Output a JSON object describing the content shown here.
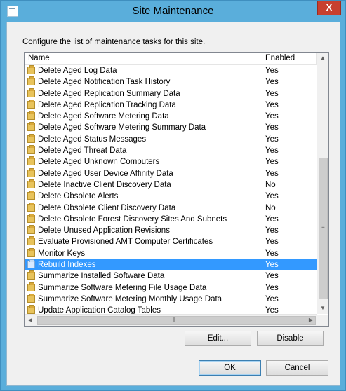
{
  "window": {
    "title": "Site Maintenance",
    "close_label": "X"
  },
  "description": "Configure the list of maintenance tasks for this site.",
  "list": {
    "columns": {
      "name": "Name",
      "enabled": "Enabled"
    },
    "rows": [
      {
        "name": "Delete Aged Log Data",
        "enabled": "Yes",
        "selected": false
      },
      {
        "name": "Delete Aged Notification Task History",
        "enabled": "Yes",
        "selected": false
      },
      {
        "name": "Delete Aged Replication Summary Data",
        "enabled": "Yes",
        "selected": false
      },
      {
        "name": "Delete Aged Replication Tracking Data",
        "enabled": "Yes",
        "selected": false
      },
      {
        "name": "Delete Aged Software Metering Data",
        "enabled": "Yes",
        "selected": false
      },
      {
        "name": "Delete Aged Software Metering Summary Data",
        "enabled": "Yes",
        "selected": false
      },
      {
        "name": "Delete Aged Status Messages",
        "enabled": "Yes",
        "selected": false
      },
      {
        "name": "Delete Aged Threat Data",
        "enabled": "Yes",
        "selected": false
      },
      {
        "name": "Delete Aged Unknown Computers",
        "enabled": "Yes",
        "selected": false
      },
      {
        "name": "Delete Aged User Device Affinity Data",
        "enabled": "Yes",
        "selected": false
      },
      {
        "name": "Delete Inactive Client Discovery Data",
        "enabled": "No",
        "selected": false
      },
      {
        "name": "Delete Obsolete Alerts",
        "enabled": "Yes",
        "selected": false
      },
      {
        "name": "Delete Obsolete Client Discovery Data",
        "enabled": "No",
        "selected": false
      },
      {
        "name": "Delete Obsolete Forest Discovery Sites And Subnets",
        "enabled": "Yes",
        "selected": false
      },
      {
        "name": "Delete Unused Application Revisions",
        "enabled": "Yes",
        "selected": false
      },
      {
        "name": "Evaluate Provisioned AMT Computer Certificates",
        "enabled": "Yes",
        "selected": false
      },
      {
        "name": "Monitor Keys",
        "enabled": "Yes",
        "selected": false
      },
      {
        "name": "Rebuild Indexes",
        "enabled": "Yes",
        "selected": true
      },
      {
        "name": "Summarize Installed Software Data",
        "enabled": "Yes",
        "selected": false
      },
      {
        "name": "Summarize Software Metering File Usage Data",
        "enabled": "Yes",
        "selected": false
      },
      {
        "name": "Summarize Software Metering Monthly Usage Data",
        "enabled": "Yes",
        "selected": false
      },
      {
        "name": "Update Application Catalog Tables",
        "enabled": "Yes",
        "selected": false
      }
    ],
    "icon": "task-icon",
    "selection_color": "#3399ff"
  },
  "buttons": {
    "edit": "Edit...",
    "disable": "Disable",
    "ok": "OK",
    "cancel": "Cancel"
  },
  "colors": {
    "frame": "#5aaedb",
    "close": "#c7402f"
  }
}
